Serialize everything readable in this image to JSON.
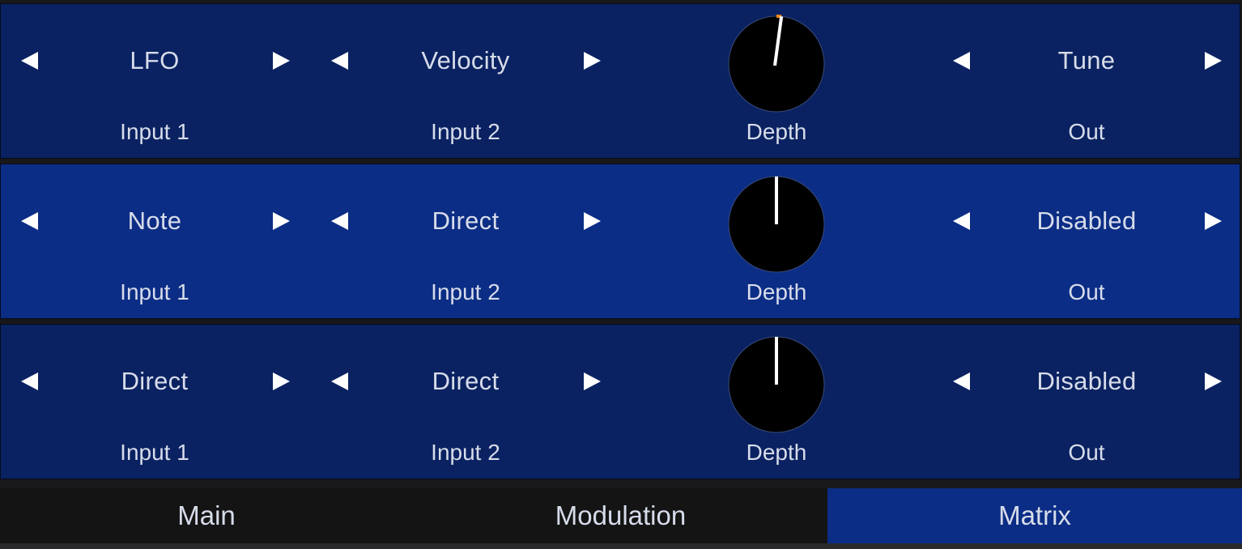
{
  "matrix": {
    "slots": [
      {
        "input1": {
          "value": "LFO",
          "label": "Input 1"
        },
        "input2": {
          "value": "Velocity",
          "label": "Input 2"
        },
        "depth": {
          "label": "Depth",
          "value_fraction": 0.52
        },
        "out": {
          "value": "Tune",
          "label": "Out"
        }
      },
      {
        "input1": {
          "value": "Note",
          "label": "Input 1"
        },
        "input2": {
          "value": "Direct",
          "label": "Input 2"
        },
        "depth": {
          "label": "Depth",
          "value_fraction": 0.5
        },
        "out": {
          "value": "Disabled",
          "label": "Out"
        }
      },
      {
        "input1": {
          "value": "Direct",
          "label": "Input 1"
        },
        "input2": {
          "value": "Direct",
          "label": "Input 2"
        },
        "depth": {
          "label": "Depth",
          "value_fraction": 0.5
        },
        "out": {
          "value": "Disabled",
          "label": "Out"
        }
      }
    ]
  },
  "arrows": {
    "left_icon": "triangle-left-icon",
    "right_icon": "triangle-right-icon"
  },
  "tabs": [
    {
      "label": "Main",
      "active": false
    },
    {
      "label": "Modulation",
      "active": false
    },
    {
      "label": "Matrix",
      "active": true
    }
  ],
  "colors": {
    "row_dark": "#0a2261",
    "row_light": "#0b2d85",
    "knob_body": "#000000",
    "knob_indicator": "#ffffff",
    "knob_arc": "#f08a1c",
    "text": "#d7dcea",
    "tab_active": "#0b2d85",
    "tabbar": "#141414"
  }
}
